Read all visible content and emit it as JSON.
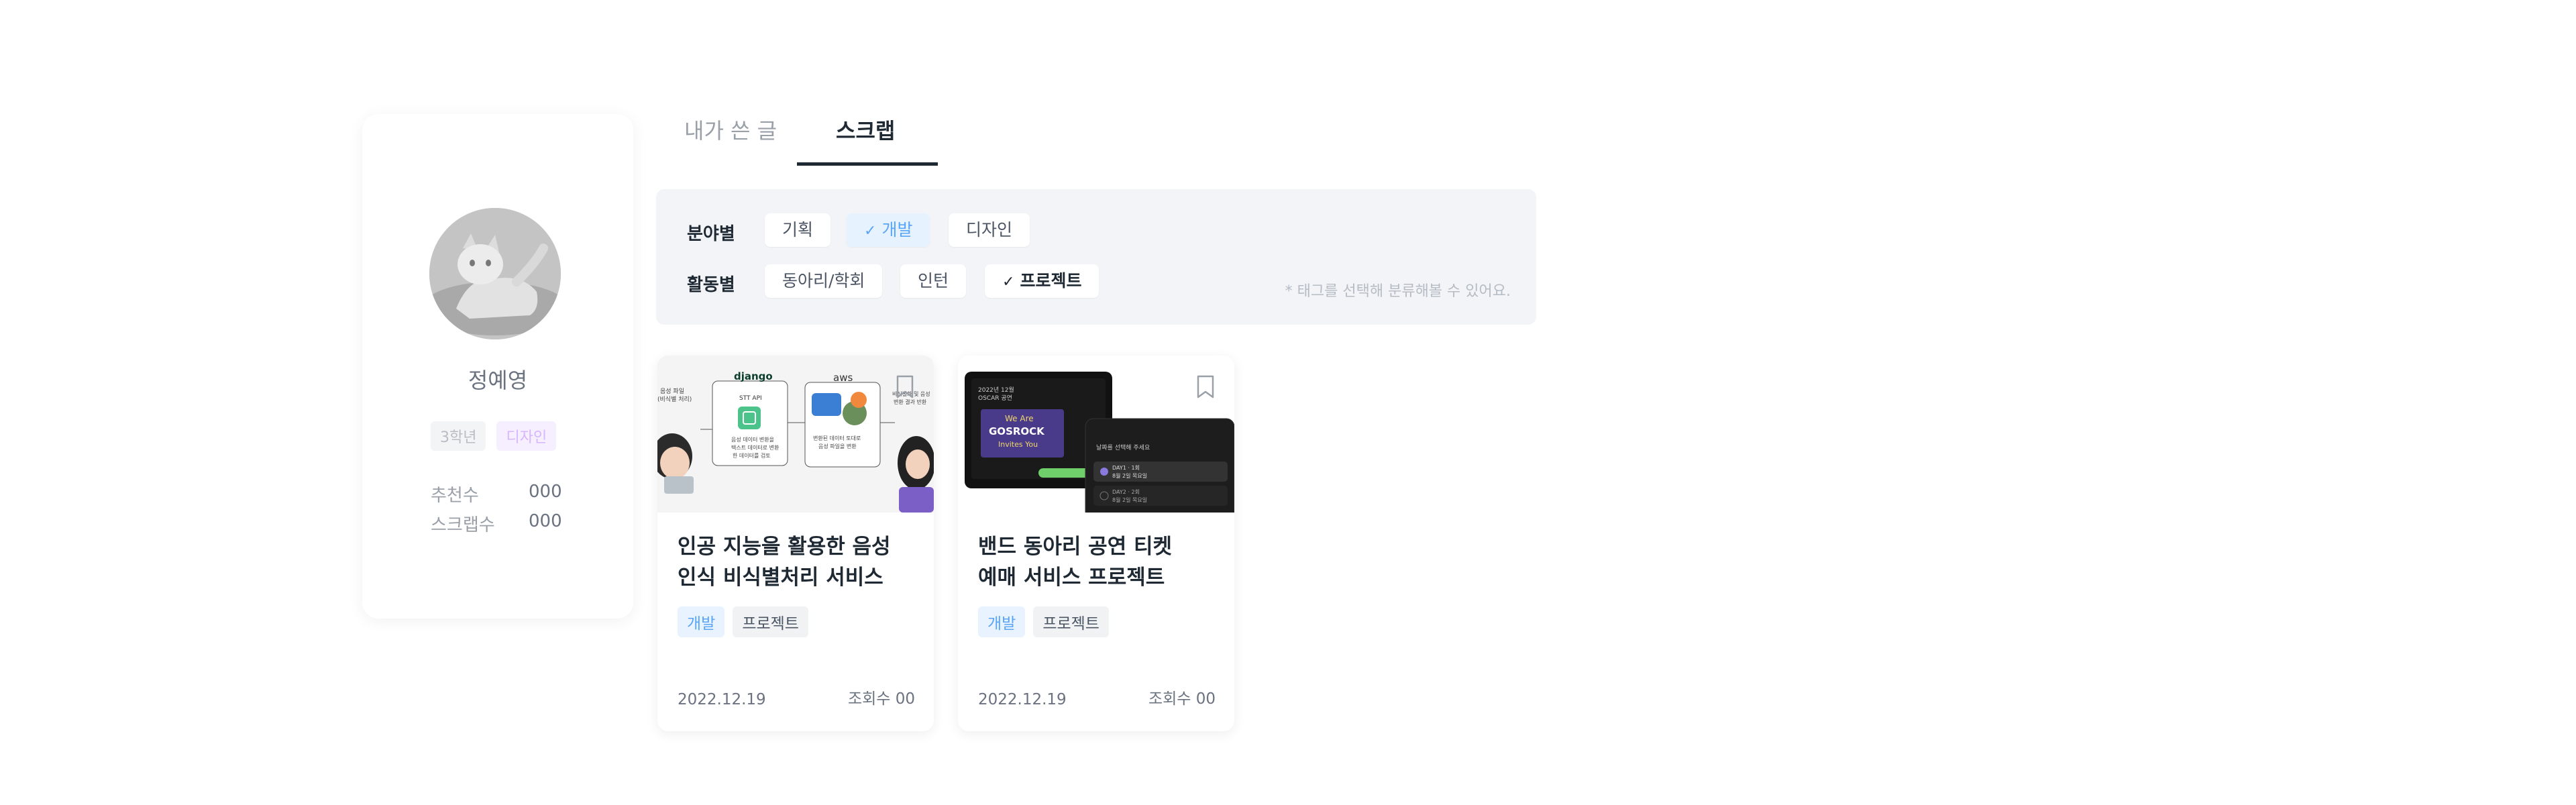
{
  "profile": {
    "name": "정예영",
    "grade": "3학년",
    "field": "디자인",
    "stats": [
      {
        "label": "추천수",
        "value": "000"
      },
      {
        "label": "스크랩수",
        "value": "000"
      }
    ]
  },
  "tabs": [
    {
      "label": "내가 쓴 글",
      "active": false
    },
    {
      "label": "스크랩",
      "active": true
    }
  ],
  "filter": {
    "field_label": "분야별",
    "field_tags": [
      {
        "label": "기획",
        "selected": false
      },
      {
        "label": "개발",
        "selected": true
      },
      {
        "label": "디자인",
        "selected": false
      }
    ],
    "activity_label": "활동별",
    "activity_tags": [
      {
        "label": "동아리/학회",
        "selected": false
      },
      {
        "label": "인턴",
        "selected": false
      },
      {
        "label": "프로젝트",
        "selected": true
      }
    ],
    "hint": "* 태그를 선택해 분류해볼 수 있어요.",
    "check_icon": "check-icon"
  },
  "posts": [
    {
      "title_line1": "인공 지능을 활용한 음성",
      "title_line2": "인식 비식별처리 서비스",
      "tags": [
        "개발",
        "프로젝트"
      ],
      "date": "2022.12.19",
      "views": "조회수 00",
      "thumb": {
        "django": "django",
        "aws": "aws",
        "api": "STT API",
        "note1": "음성 데이터 변환을",
        "note2": "텍스트 데이터로 변환",
        "note3": "한 데이터를 검토",
        "note4": "변환된 데이터 토대로",
        "note5": "음성 파일을 변환",
        "side_left": "음성 파일",
        "side_left2": "(비식별 처리)",
        "side_right": "비식별화 및 음성",
        "side_right2": "변환 결과 반환"
      }
    },
    {
      "title_line1": "밴드 동아리 공연 티켓",
      "title_line2": "예매 서비스 프로젝트",
      "tags": [
        "개발",
        "프로젝트"
      ],
      "date": "2022.12.19",
      "views": "조회수 00",
      "thumb": {
        "poster_top": "2022년 12월",
        "poster_top2": "OSCAR 공연",
        "poster_we": "We Are",
        "poster_band": "GOSROCK",
        "poster_inv": "Invites You",
        "phone_title": "날짜를 선택해 주세요",
        "phone_opt1": "DAY1 · 1회",
        "phone_opt1b": "8월 2일 목요일",
        "phone_opt2": "DAY2 · 2회",
        "phone_opt2b": "8월 2일 목요일"
      }
    }
  ],
  "colors": {
    "accent_blue": "#5aa5f5",
    "design_purple": "#d7b6ff",
    "panel_bg": "#f2f4f7"
  }
}
